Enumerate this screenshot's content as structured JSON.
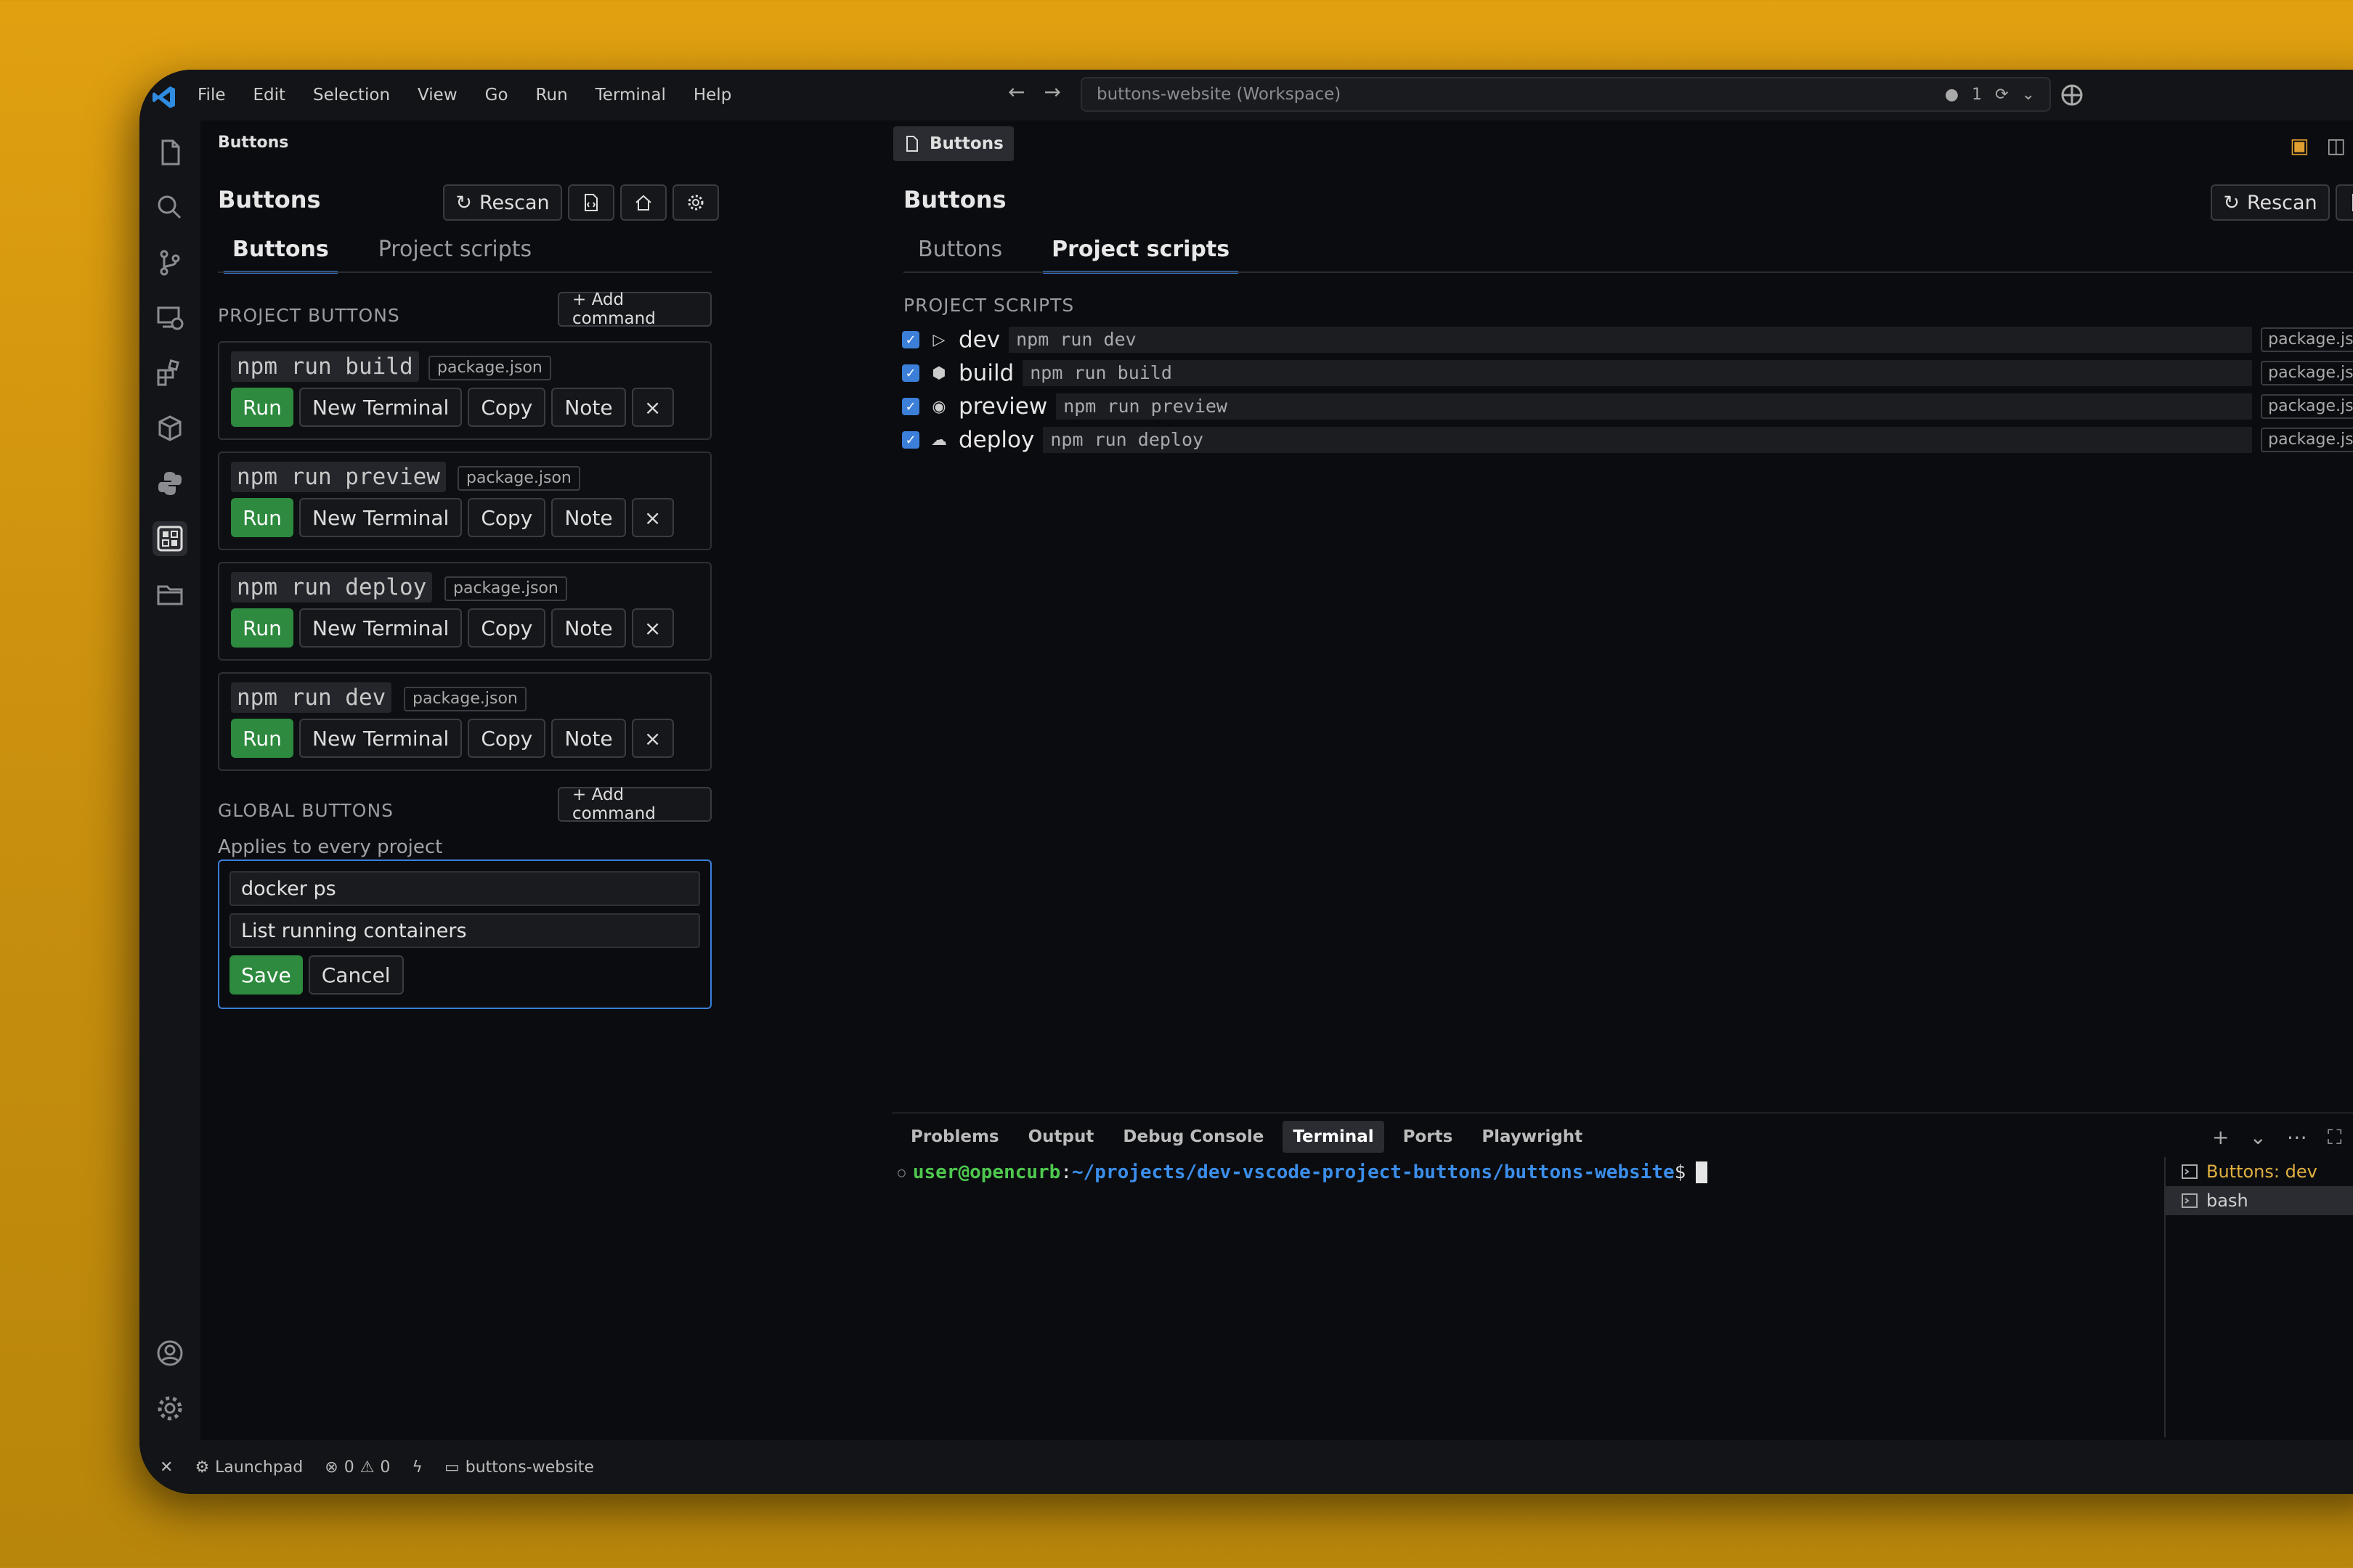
{
  "menu": [
    "File",
    "Edit",
    "Selection",
    "View",
    "Go",
    "Run",
    "Terminal",
    "Help"
  ],
  "command_center": {
    "workspace": "buttons-website (Workspace)",
    "notifications": "1"
  },
  "sidebar": {
    "header": "Buttons",
    "title": "Buttons",
    "rescan": "Rescan",
    "tabs": [
      "Buttons",
      "Project scripts"
    ],
    "project_buttons_label": "PROJECT BUTTONS",
    "add_command": "+ Add command",
    "commands": [
      {
        "name": "npm run build",
        "source": "package.json"
      },
      {
        "name": "npm run preview",
        "source": "package.json"
      },
      {
        "name": "npm run deploy",
        "source": "package.json"
      },
      {
        "name": "npm run dev",
        "source": "package.json"
      }
    ],
    "actions": {
      "run": "Run",
      "new_terminal": "New Terminal",
      "copy": "Copy",
      "note": "Note",
      "remove": "×"
    },
    "global_buttons_label": "GLOBAL BUTTONS",
    "applies": "Applies to every project",
    "global_form": {
      "command": "docker ps",
      "description": "List running containers",
      "save": "Save",
      "cancel": "Cancel"
    }
  },
  "editor": {
    "tab": "Buttons",
    "title": "Buttons",
    "rescan": "Rescan",
    "tabs": [
      "Buttons",
      "Project scripts"
    ],
    "section": "PROJECT SCRIPTS",
    "scripts": [
      {
        "name": "dev",
        "cmd": "npm run dev",
        "source": "package.json",
        "icon": "play-icon"
      },
      {
        "name": "build",
        "cmd": "npm run build",
        "source": "package.json",
        "icon": "package-icon"
      },
      {
        "name": "preview",
        "cmd": "npm run preview",
        "source": "package.json",
        "icon": "eye-icon"
      },
      {
        "name": "deploy",
        "cmd": "npm run deploy",
        "source": "package.json",
        "icon": "cloud-upload-icon"
      }
    ]
  },
  "panel": {
    "tabs": [
      "Problems",
      "Output",
      "Debug Console",
      "Terminal",
      "Ports",
      "Playwright"
    ],
    "active_tab": "Terminal",
    "prompt_user": "user@opencurb",
    "prompt_sep": ":",
    "prompt_path": "~/projects/dev-vscode-project-buttons/buttons-website",
    "prompt_end": "$",
    "terminals": [
      "Buttons: dev",
      "bash"
    ]
  },
  "statusbar": {
    "launchpad": "Launchpad",
    "errors": "0",
    "warnings": "0",
    "folder": "buttons-website"
  },
  "colors": {
    "accent": "#3b7fd9",
    "run_green": "#2d8a3e",
    "terminal_user": "#4ec94e",
    "terminal_path": "#3b8eea"
  }
}
